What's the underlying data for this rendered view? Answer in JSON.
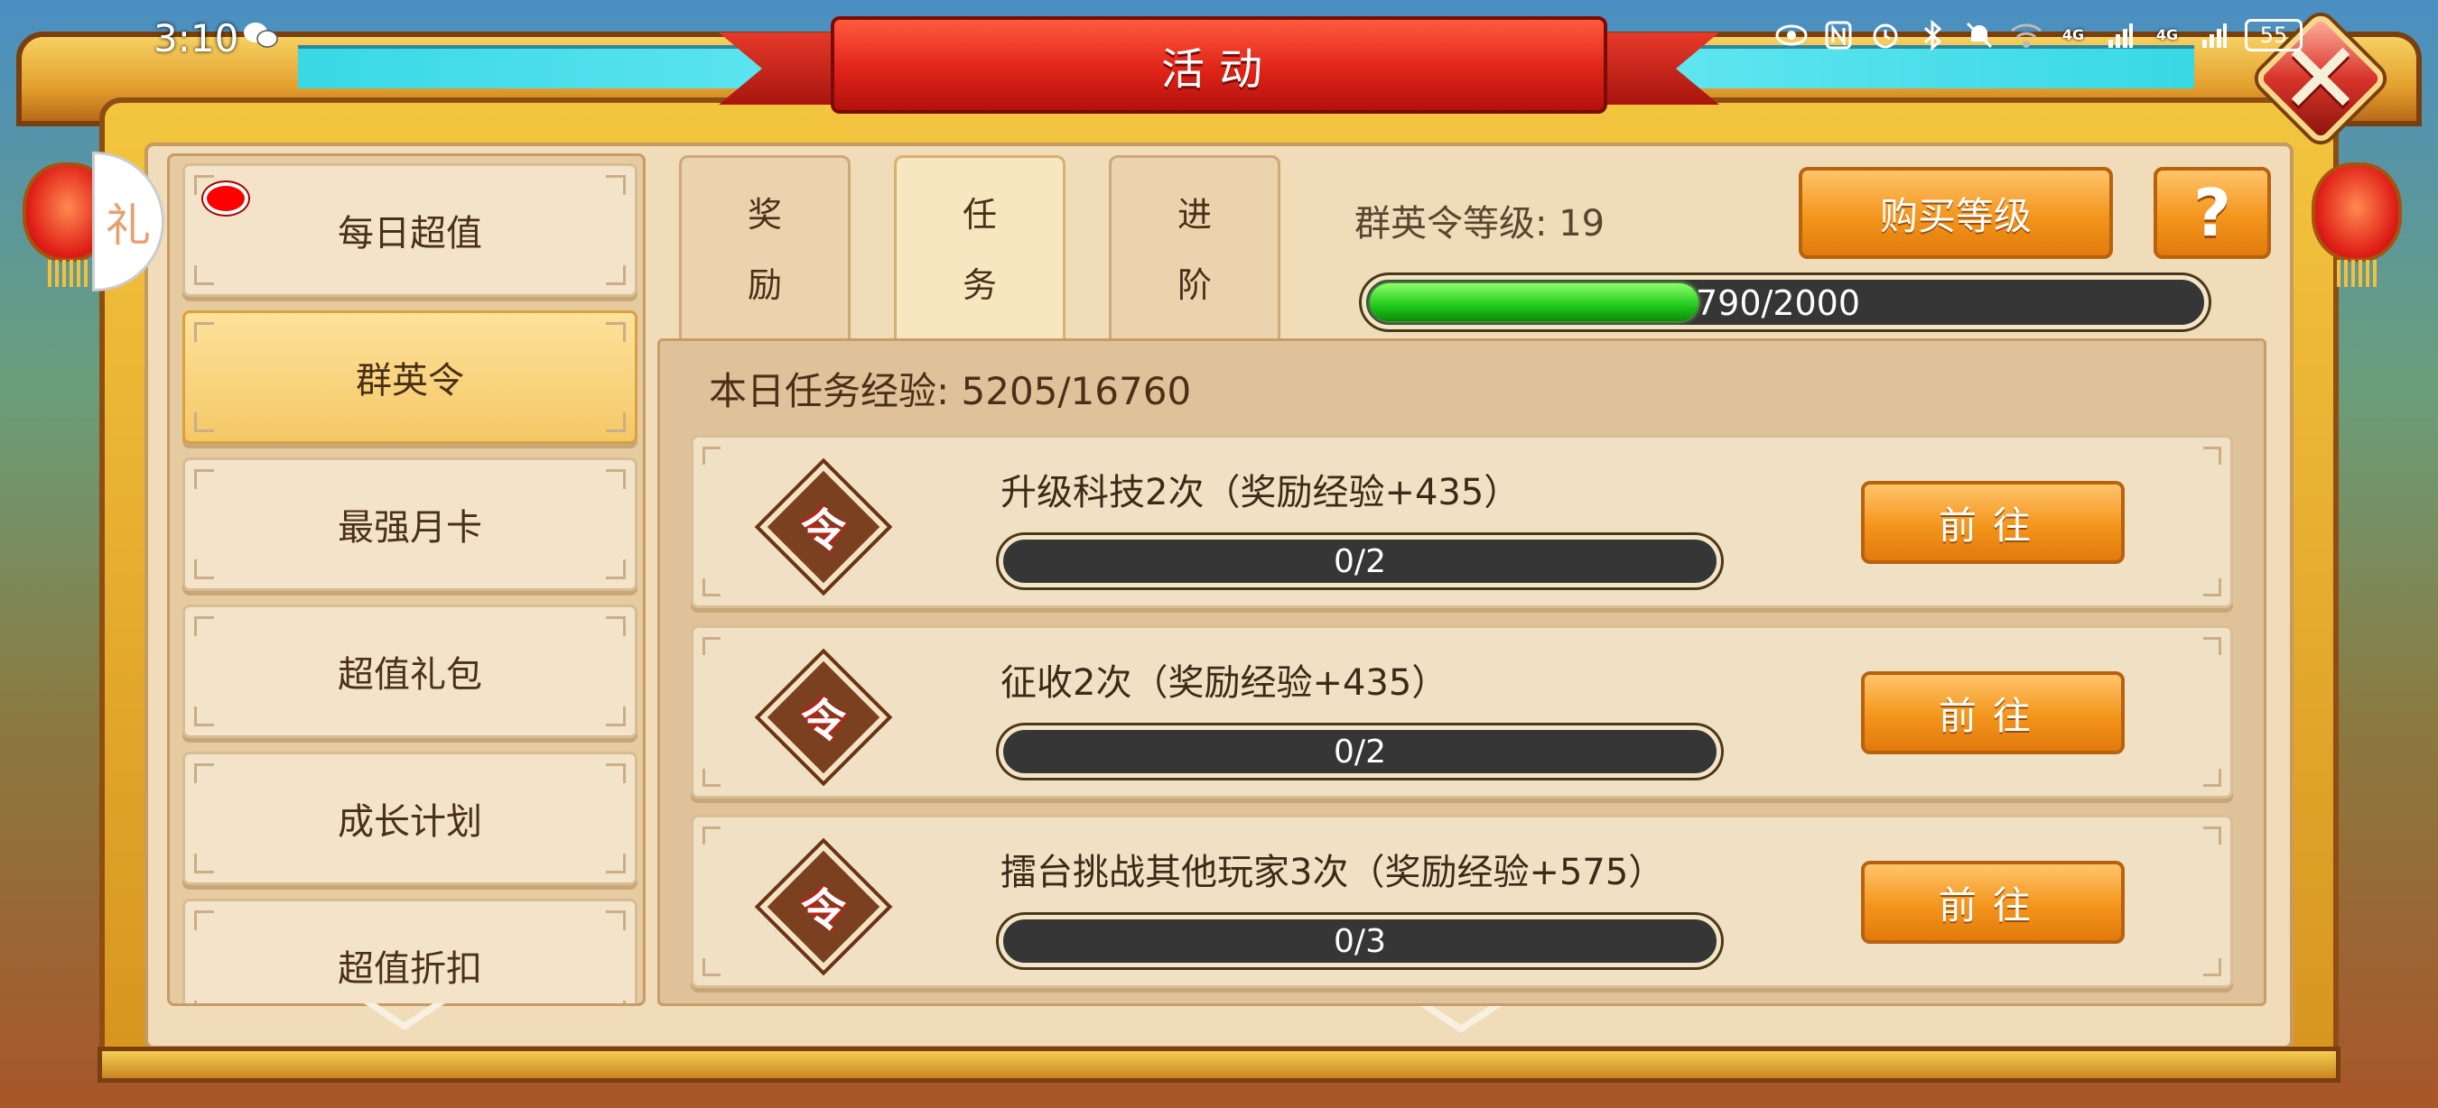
{
  "status_bar": {
    "time": "3:10",
    "net_label_1": "4G",
    "net_label_2": "4G",
    "battery": "55"
  },
  "window": {
    "title": "活动"
  },
  "gift_badge": "礼",
  "sidebar": {
    "items": [
      {
        "label": "每日超值",
        "has_notification": true
      },
      {
        "label": "群英令",
        "active": true
      },
      {
        "label": "最强月卡"
      },
      {
        "label": "超值礼包"
      },
      {
        "label": "成长计划"
      },
      {
        "label": "超值折扣"
      }
    ]
  },
  "tabs": [
    {
      "line1": "奖",
      "line2": "励"
    },
    {
      "line1": "任",
      "line2": "务",
      "active": true
    },
    {
      "line1": "进",
      "line2": "阶"
    }
  ],
  "level": {
    "label": "群英令等级: 19",
    "progress_text": "790/2000",
    "current": 790,
    "max": 2000,
    "buy_label": "购买等级",
    "help_label": "?"
  },
  "tasks": {
    "exp_label": "本日任务经验:",
    "exp_value": "5205/16760",
    "icon_char": "令",
    "go_label": "前往",
    "items": [
      {
        "title": "升级科技2次（奖励经验+435）",
        "progress": "0/2"
      },
      {
        "title": "征收2次（奖励经验+435）",
        "progress": "0/2"
      },
      {
        "title": "擂台挑战其他玩家3次（奖励经验+575）",
        "progress": "0/3"
      }
    ]
  },
  "colors": {
    "accent_orange": "#f3951c",
    "ribbon_red": "#e02418",
    "progress_green": "#1fc81a",
    "notification_red": "#ff0000"
  }
}
